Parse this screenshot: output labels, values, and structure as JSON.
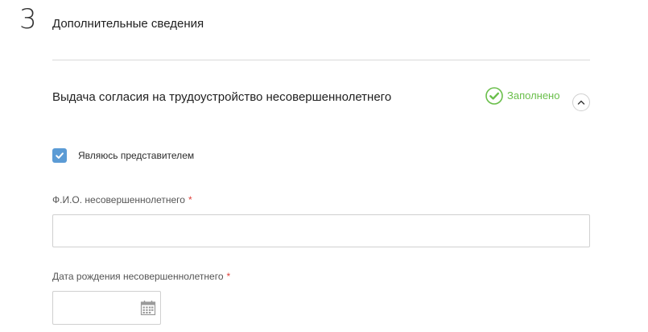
{
  "section": {
    "number": "3",
    "title": "Дополнительные сведения"
  },
  "subsection": {
    "title": "Выдача согласия на трудоустройство несовершеннолетнего",
    "status_text": "Заполнено",
    "status_icon": "check-circle-icon",
    "collapse_icon": "chevron-up-icon"
  },
  "representative": {
    "label": "Являюсь представителем",
    "checked": true
  },
  "fields": {
    "fio": {
      "label": "Ф.И.О. несовершеннолетнего",
      "required_mark": "*",
      "value": ""
    },
    "birth_date": {
      "label": "Дата рождения несовершеннолетнего",
      "required_mark": "*",
      "value": "",
      "icon": "calendar-icon"
    }
  },
  "colors": {
    "accent_green": "#6abf4b",
    "checkbox_blue": "#5b9bd5",
    "required_red": "#e0403a",
    "divider": "#d9d9d9"
  }
}
